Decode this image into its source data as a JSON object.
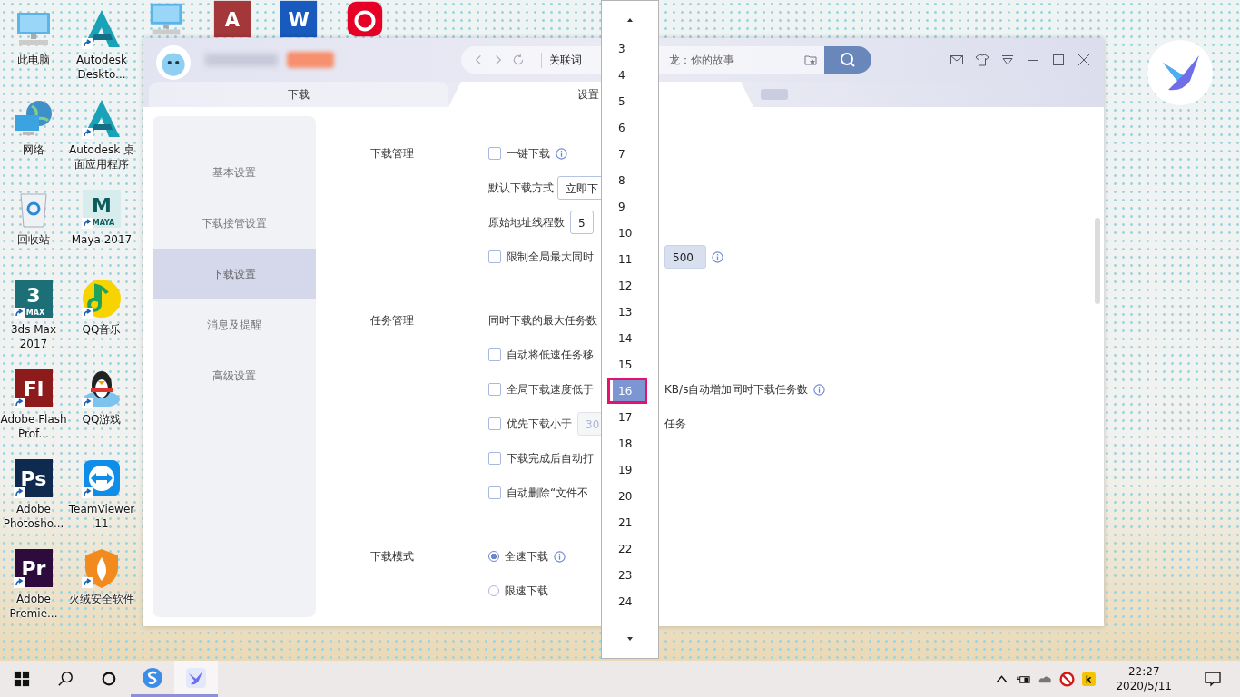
{
  "top_icons": [
    {
      "kind": "computer"
    },
    {
      "kind": "tile",
      "color": "#a4373a",
      "glyph": "A"
    },
    {
      "kind": "tile",
      "color": "#185abd",
      "glyph": "W"
    },
    {
      "kind": "netease"
    }
  ],
  "desktop_icons": [
    {
      "kind": "computer",
      "label": "此电脑",
      "shortcut": false
    },
    {
      "kind": "network",
      "label": "网络",
      "shortcut": false
    },
    {
      "kind": "recycle",
      "label": "回收站",
      "shortcut": false
    },
    {
      "kind": "tile",
      "color": "#1c6f77",
      "glyph": "3",
      "sub": "MAX",
      "label": "3ds Max 2017",
      "shortcut": true
    },
    {
      "kind": "tile",
      "color": "#8e1b1b",
      "glyph": "Fl",
      "label": "Adobe Flash Prof...",
      "shortcut": true
    },
    {
      "kind": "tile",
      "color": "#0f2a4f",
      "glyph": "Ps",
      "label": "Adobe Photosho...",
      "shortcut": true
    },
    {
      "kind": "tile",
      "color": "#2d0b3d",
      "glyph": "Pr",
      "label": "Adobe Premie...",
      "shortcut": true
    },
    {
      "kind": "autodesk",
      "label": "Autodesk Deskto...",
      "shortcut": true
    },
    {
      "kind": "autodesk",
      "label": "Autodesk 桌面应用程序",
      "shortcut": true
    },
    {
      "kind": "tile",
      "color": "#d7ecec",
      "glyph": "M",
      "sub": "MAYA",
      "label": "Maya 2017",
      "shortcut": true
    },
    {
      "kind": "music",
      "label": "QQ音乐",
      "shortcut": true
    },
    {
      "kind": "penguin",
      "label": "QQ游戏",
      "shortcut": true
    },
    {
      "kind": "teamviewer",
      "label": "TeamViewer 11",
      "shortcut": true
    },
    {
      "kind": "shield",
      "label": "火绒安全软件",
      "shortcut": true
    }
  ],
  "app_window": {
    "tabs": [
      {
        "label": "下载",
        "selected": false
      },
      {
        "label": "设置",
        "selected": true
      }
    ],
    "search": {
      "scope": "关联词",
      "placeholder": "龙：你的故事"
    },
    "sidebar": [
      {
        "label": "基本设置",
        "selected": false
      },
      {
        "label": "下载接管设置",
        "selected": false
      },
      {
        "label": "下载设置",
        "selected": true
      },
      {
        "label": "消息及提醒",
        "selected": false
      },
      {
        "label": "高级设置",
        "selected": false
      }
    ],
    "sections": [
      {
        "title": "下载管理",
        "rows": [
          {
            "kind": "checkbox",
            "checked": false,
            "label": "一键下载",
            "info": true
          },
          {
            "kind": "text",
            "label": "默认下载方式",
            "field": {
              "kind": "select",
              "value": "立即下"
            }
          },
          {
            "kind": "text",
            "label": "原始地址线程数",
            "field": {
              "kind": "input",
              "value": "5"
            }
          },
          {
            "kind": "checkbox",
            "checked": false,
            "label": "限制全局最大同时",
            "right": {
              "field": "500",
              "info": true
            }
          }
        ]
      },
      {
        "title": "任务管理",
        "rows": [
          {
            "kind": "text",
            "label": "同时下载的最大任务数"
          },
          {
            "kind": "checkbox",
            "checked": false,
            "label": "自动将低速任务移"
          },
          {
            "kind": "checkbox",
            "checked": false,
            "label": "全局下载速度低于",
            "right": {
              "text": "KB/s自动增加同时下载任务数",
              "info": true
            }
          },
          {
            "kind": "checkbox",
            "checked": false,
            "label": "优先下载小于",
            "field": {
              "kind": "disabled",
              "value": "30"
            },
            "right": {
              "text": "任务"
            }
          },
          {
            "kind": "checkbox",
            "checked": false,
            "label": "下载完成后自动打"
          },
          {
            "kind": "checkbox",
            "checked": false,
            "label": "自动删除“文件不"
          }
        ]
      },
      {
        "title": "下载模式",
        "rows": [
          {
            "kind": "radio",
            "selected": true,
            "label": "全速下载",
            "info": true
          },
          {
            "kind": "radio",
            "selected": false,
            "label": "限速下载"
          }
        ]
      }
    ]
  },
  "dropdown": {
    "options": [
      {
        "label": "3",
        "selected": false
      },
      {
        "label": "4",
        "selected": false
      },
      {
        "label": "5",
        "selected": false
      },
      {
        "label": "6",
        "selected": false
      },
      {
        "label": "7",
        "selected": false
      },
      {
        "label": "8",
        "selected": false
      },
      {
        "label": "9",
        "selected": false
      },
      {
        "label": "10",
        "selected": false
      },
      {
        "label": "11",
        "selected": false
      },
      {
        "label": "12",
        "selected": false
      },
      {
        "label": "13",
        "selected": false
      },
      {
        "label": "14",
        "selected": false
      },
      {
        "label": "15",
        "selected": false
      },
      {
        "label": "16",
        "selected": true
      },
      {
        "label": "17",
        "selected": false
      },
      {
        "label": "18",
        "selected": false
      },
      {
        "label": "19",
        "selected": false
      },
      {
        "label": "20",
        "selected": false
      },
      {
        "label": "21",
        "selected": false
      },
      {
        "label": "22",
        "selected": false
      },
      {
        "label": "23",
        "selected": false
      },
      {
        "label": "24",
        "selected": false
      }
    ]
  },
  "taskbar": {
    "items": [
      {
        "kind": "start",
        "running": false,
        "selected": false
      },
      {
        "kind": "search",
        "running": false,
        "selected": false
      },
      {
        "kind": "cortana",
        "running": false,
        "selected": false
      },
      {
        "kind": "sogou",
        "running": true,
        "selected": false
      },
      {
        "kind": "bird",
        "running": true,
        "selected": true
      }
    ],
    "time": "22:27",
    "date": "2020/5/11"
  }
}
